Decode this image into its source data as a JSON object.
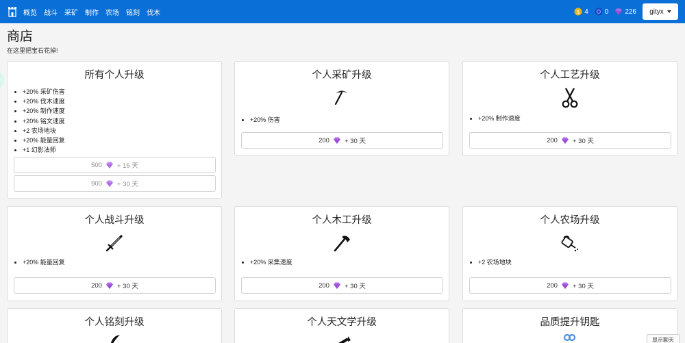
{
  "nav": {
    "items": [
      "概览",
      "战斗",
      "采矿",
      "制作",
      "农场",
      "铭刻",
      "伐木"
    ],
    "coins": "4",
    "tokens": "0",
    "gems": "226",
    "user": "gityx"
  },
  "page": {
    "title": "商店",
    "subtitle": "在这里把宝石花掉!"
  },
  "colors": {
    "navbar": "#0a6fd6",
    "gem": "#b56ee8",
    "coin": "#e8b21c",
    "token": "#1b46c2"
  },
  "cards": [
    {
      "title": "所有个人升级",
      "icon": "none",
      "perks": [
        "+20% 采矿伤害",
        "+20% 伐木速度",
        "+20% 制作速度",
        "+20% 铭文速度",
        "+2 农场地块",
        "+20% 能量回复",
        "+1 幻影法师"
      ],
      "buttons": [
        {
          "price": "500",
          "duration": "+ 15 天"
        },
        {
          "price": "900",
          "duration": "+ 30 天"
        }
      ]
    },
    {
      "title": "个人采矿升级",
      "icon": "pickaxe-icon",
      "perks": [
        "+20% 伤害"
      ],
      "buttons": [
        {
          "price": "200",
          "duration": "+ 30 天"
        }
      ]
    },
    {
      "title": "个人工艺升级",
      "icon": "scissors-icon",
      "perks": [
        "+20% 制作速度"
      ],
      "buttons": [
        {
          "price": "200",
          "duration": "+ 30 天"
        }
      ]
    },
    {
      "title": "个人战斗升级",
      "icon": "sword-icon",
      "perks": [
        "+20% 能量回复"
      ],
      "buttons": [
        {
          "price": "200",
          "duration": "+ 30 天"
        }
      ]
    },
    {
      "title": "个人木工升级",
      "icon": "axe-icon",
      "perks": [
        "+20% 采集速度"
      ],
      "buttons": [
        {
          "price": "200",
          "duration": "+ 30 天"
        }
      ]
    },
    {
      "title": "个人农场升级",
      "icon": "watering-can-icon",
      "perks": [
        "+2 农场地块"
      ],
      "buttons": [
        {
          "price": "200",
          "duration": "+ 30 天"
        }
      ]
    },
    {
      "title": "个人铭刻升级",
      "icon": "quill-icon",
      "perks": [],
      "buttons": []
    },
    {
      "title": "个人天文学升级",
      "icon": "telescope-icon",
      "perks": [],
      "buttons": []
    },
    {
      "title": "品质提升钥匙",
      "icon": "key-icon",
      "perks": [],
      "buttons": []
    }
  ],
  "chat": {
    "label": "显示聊天"
  }
}
